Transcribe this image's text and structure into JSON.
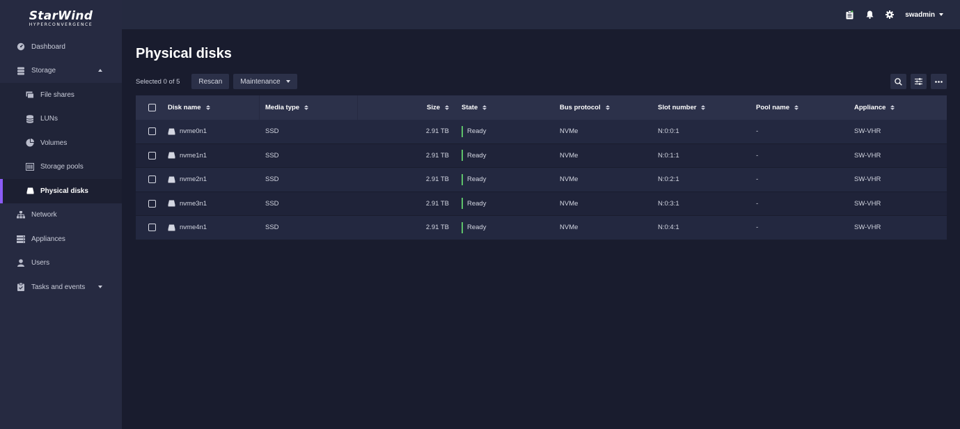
{
  "logo": {
    "brand": "StarWind",
    "sub": "HYPERCONVERGENCE"
  },
  "sidebar": {
    "items": [
      {
        "label": "Dashboard",
        "icon": "dashboard-icon"
      },
      {
        "label": "Storage",
        "icon": "storage-icon",
        "expanded": true
      },
      {
        "label": "File shares",
        "icon": "file-shares-icon"
      },
      {
        "label": "LUNs",
        "icon": "luns-icon"
      },
      {
        "label": "Volumes",
        "icon": "volumes-icon"
      },
      {
        "label": "Storage pools",
        "icon": "storage-pools-icon"
      },
      {
        "label": "Physical disks",
        "icon": "physical-disk-icon",
        "active": true
      },
      {
        "label": "Network",
        "icon": "network-icon"
      },
      {
        "label": "Appliances",
        "icon": "appliances-icon"
      },
      {
        "label": "Users",
        "icon": "user-icon"
      },
      {
        "label": "Tasks and events",
        "icon": "tasks-icon",
        "expanded": false
      }
    ]
  },
  "topbar": {
    "username": "swadmin"
  },
  "page": {
    "title": "Physical disks"
  },
  "toolbar": {
    "selected_text": "Selected 0 of 5",
    "rescan_label": "Rescan",
    "maintenance_label": "Maintenance"
  },
  "table": {
    "headers": [
      "Disk name",
      "Media type",
      "Size",
      "State",
      "Bus protocol",
      "Slot number",
      "Pool name",
      "Appliance"
    ],
    "rows": [
      {
        "name": "nvme0n1",
        "media": "SSD",
        "size": "2.91 TB",
        "state": "Ready",
        "bus": "NVMe",
        "slot": "N:0:0:1",
        "pool": "-",
        "appliance": "SW-VHR"
      },
      {
        "name": "nvme1n1",
        "media": "SSD",
        "size": "2.91 TB",
        "state": "Ready",
        "bus": "NVMe",
        "slot": "N:0:1:1",
        "pool": "-",
        "appliance": "SW-VHR"
      },
      {
        "name": "nvme2n1",
        "media": "SSD",
        "size": "2.91 TB",
        "state": "Ready",
        "bus": "NVMe",
        "slot": "N:0:2:1",
        "pool": "-",
        "appliance": "SW-VHR"
      },
      {
        "name": "nvme3n1",
        "media": "SSD",
        "size": "2.91 TB",
        "state": "Ready",
        "bus": "NVMe",
        "slot": "N:0:3:1",
        "pool": "-",
        "appliance": "SW-VHR"
      },
      {
        "name": "nvme4n1",
        "media": "SSD",
        "size": "2.91 TB",
        "state": "Ready",
        "bus": "NVMe",
        "slot": "N:0:4:1",
        "pool": "-",
        "appliance": "SW-VHR"
      }
    ]
  },
  "colors": {
    "accent": "#8b5cf6",
    "ready": "#5ec26a",
    "background": "#191c2e",
    "sidebar": "#262a41"
  }
}
